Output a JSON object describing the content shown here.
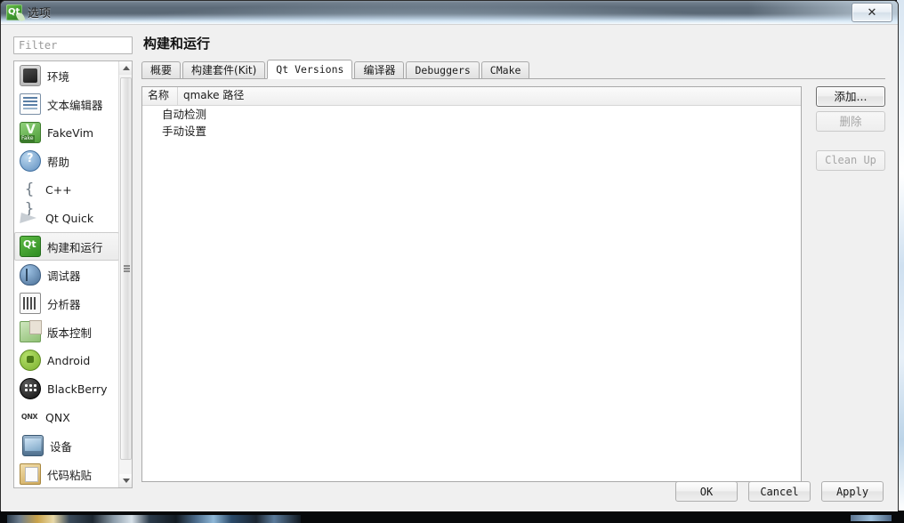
{
  "window": {
    "title": "选项",
    "app_icon": "qt-logo-icon",
    "close_label": "✕"
  },
  "filter": {
    "placeholder": "Filter",
    "value": ""
  },
  "sidebar": {
    "scrollbar": {
      "up_arrow": "scroll-up-arrow-icon",
      "down_arrow": "scroll-down-arrow-icon"
    },
    "items": [
      {
        "label": "环境",
        "icon": "environment-icon",
        "selected": false
      },
      {
        "label": "文本编辑器",
        "icon": "text-editor-icon",
        "selected": false
      },
      {
        "label": "FakeVim",
        "icon": "fakevim-icon",
        "selected": false
      },
      {
        "label": "帮助",
        "icon": "help-icon",
        "selected": false
      },
      {
        "label": "C++",
        "icon": "cpp-icon",
        "selected": false
      },
      {
        "label": "Qt Quick",
        "icon": "qt-quick-icon",
        "selected": false
      },
      {
        "label": "构建和运行",
        "icon": "build-and-run-icon",
        "selected": true
      },
      {
        "label": "调试器",
        "icon": "debugger-icon",
        "selected": false
      },
      {
        "label": "分析器",
        "icon": "analyzer-icon",
        "selected": false
      },
      {
        "label": "版本控制",
        "icon": "version-control-icon",
        "selected": false
      },
      {
        "label": "Android",
        "icon": "android-icon",
        "selected": false
      },
      {
        "label": "BlackBerry",
        "icon": "blackberry-icon",
        "selected": false
      },
      {
        "label": "QNX",
        "icon": "qnx-icon",
        "selected": false
      },
      {
        "label": "设备",
        "icon": "device-icon",
        "selected": false
      },
      {
        "label": "代码粘贴",
        "icon": "code-paste-icon",
        "selected": false
      }
    ]
  },
  "page": {
    "title": "构建和运行",
    "tabs": [
      {
        "label": "概要",
        "script": "cjk",
        "active": false
      },
      {
        "label": "构建套件(Kit)",
        "script": "cjk",
        "active": false
      },
      {
        "label": "Qt Versions",
        "script": "latin",
        "active": true
      },
      {
        "label": "编译器",
        "script": "cjk",
        "active": false
      },
      {
        "label": "Debuggers",
        "script": "latin",
        "active": false
      },
      {
        "label": "CMake",
        "script": "latin",
        "active": false
      }
    ]
  },
  "qt_versions": {
    "columns": [
      "名称",
      "qmake 路径"
    ],
    "rows": [
      {
        "name": "自动检测",
        "qmake_path": ""
      },
      {
        "name": "手动设置",
        "qmake_path": ""
      }
    ],
    "buttons": [
      {
        "label": "添加...",
        "script": "cjk",
        "state": "focused"
      },
      {
        "label": "删除",
        "script": "cjk",
        "state": "disabled"
      },
      {
        "label": "Clean Up",
        "script": "latin",
        "state": "disabled"
      }
    ]
  },
  "dialog_buttons": [
    {
      "label": "OK"
    },
    {
      "label": "Cancel"
    },
    {
      "label": "Apply"
    }
  ]
}
